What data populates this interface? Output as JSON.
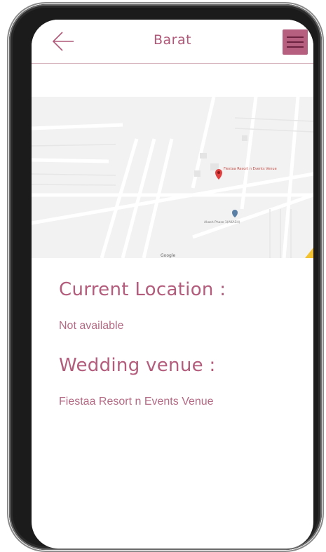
{
  "header": {
    "title": "Barat",
    "back_icon": "arrow-left-icon",
    "menu_icon": "hamburger-menu-icon"
  },
  "map": {
    "pin_label": "Fiestaa Resort n Events Venue",
    "secondary_label": "Akash Phase 1(AKASH)",
    "attribution": "Google"
  },
  "current_location": {
    "heading": "Current Location :",
    "value": "Not available"
  },
  "venue": {
    "heading": "Wedding venue :",
    "value": "Fiestaa Resort n Events Venue"
  },
  "colors": {
    "accent": "#b35c7c",
    "menu_bg": "#b65f7e",
    "pin": "#e04040"
  }
}
